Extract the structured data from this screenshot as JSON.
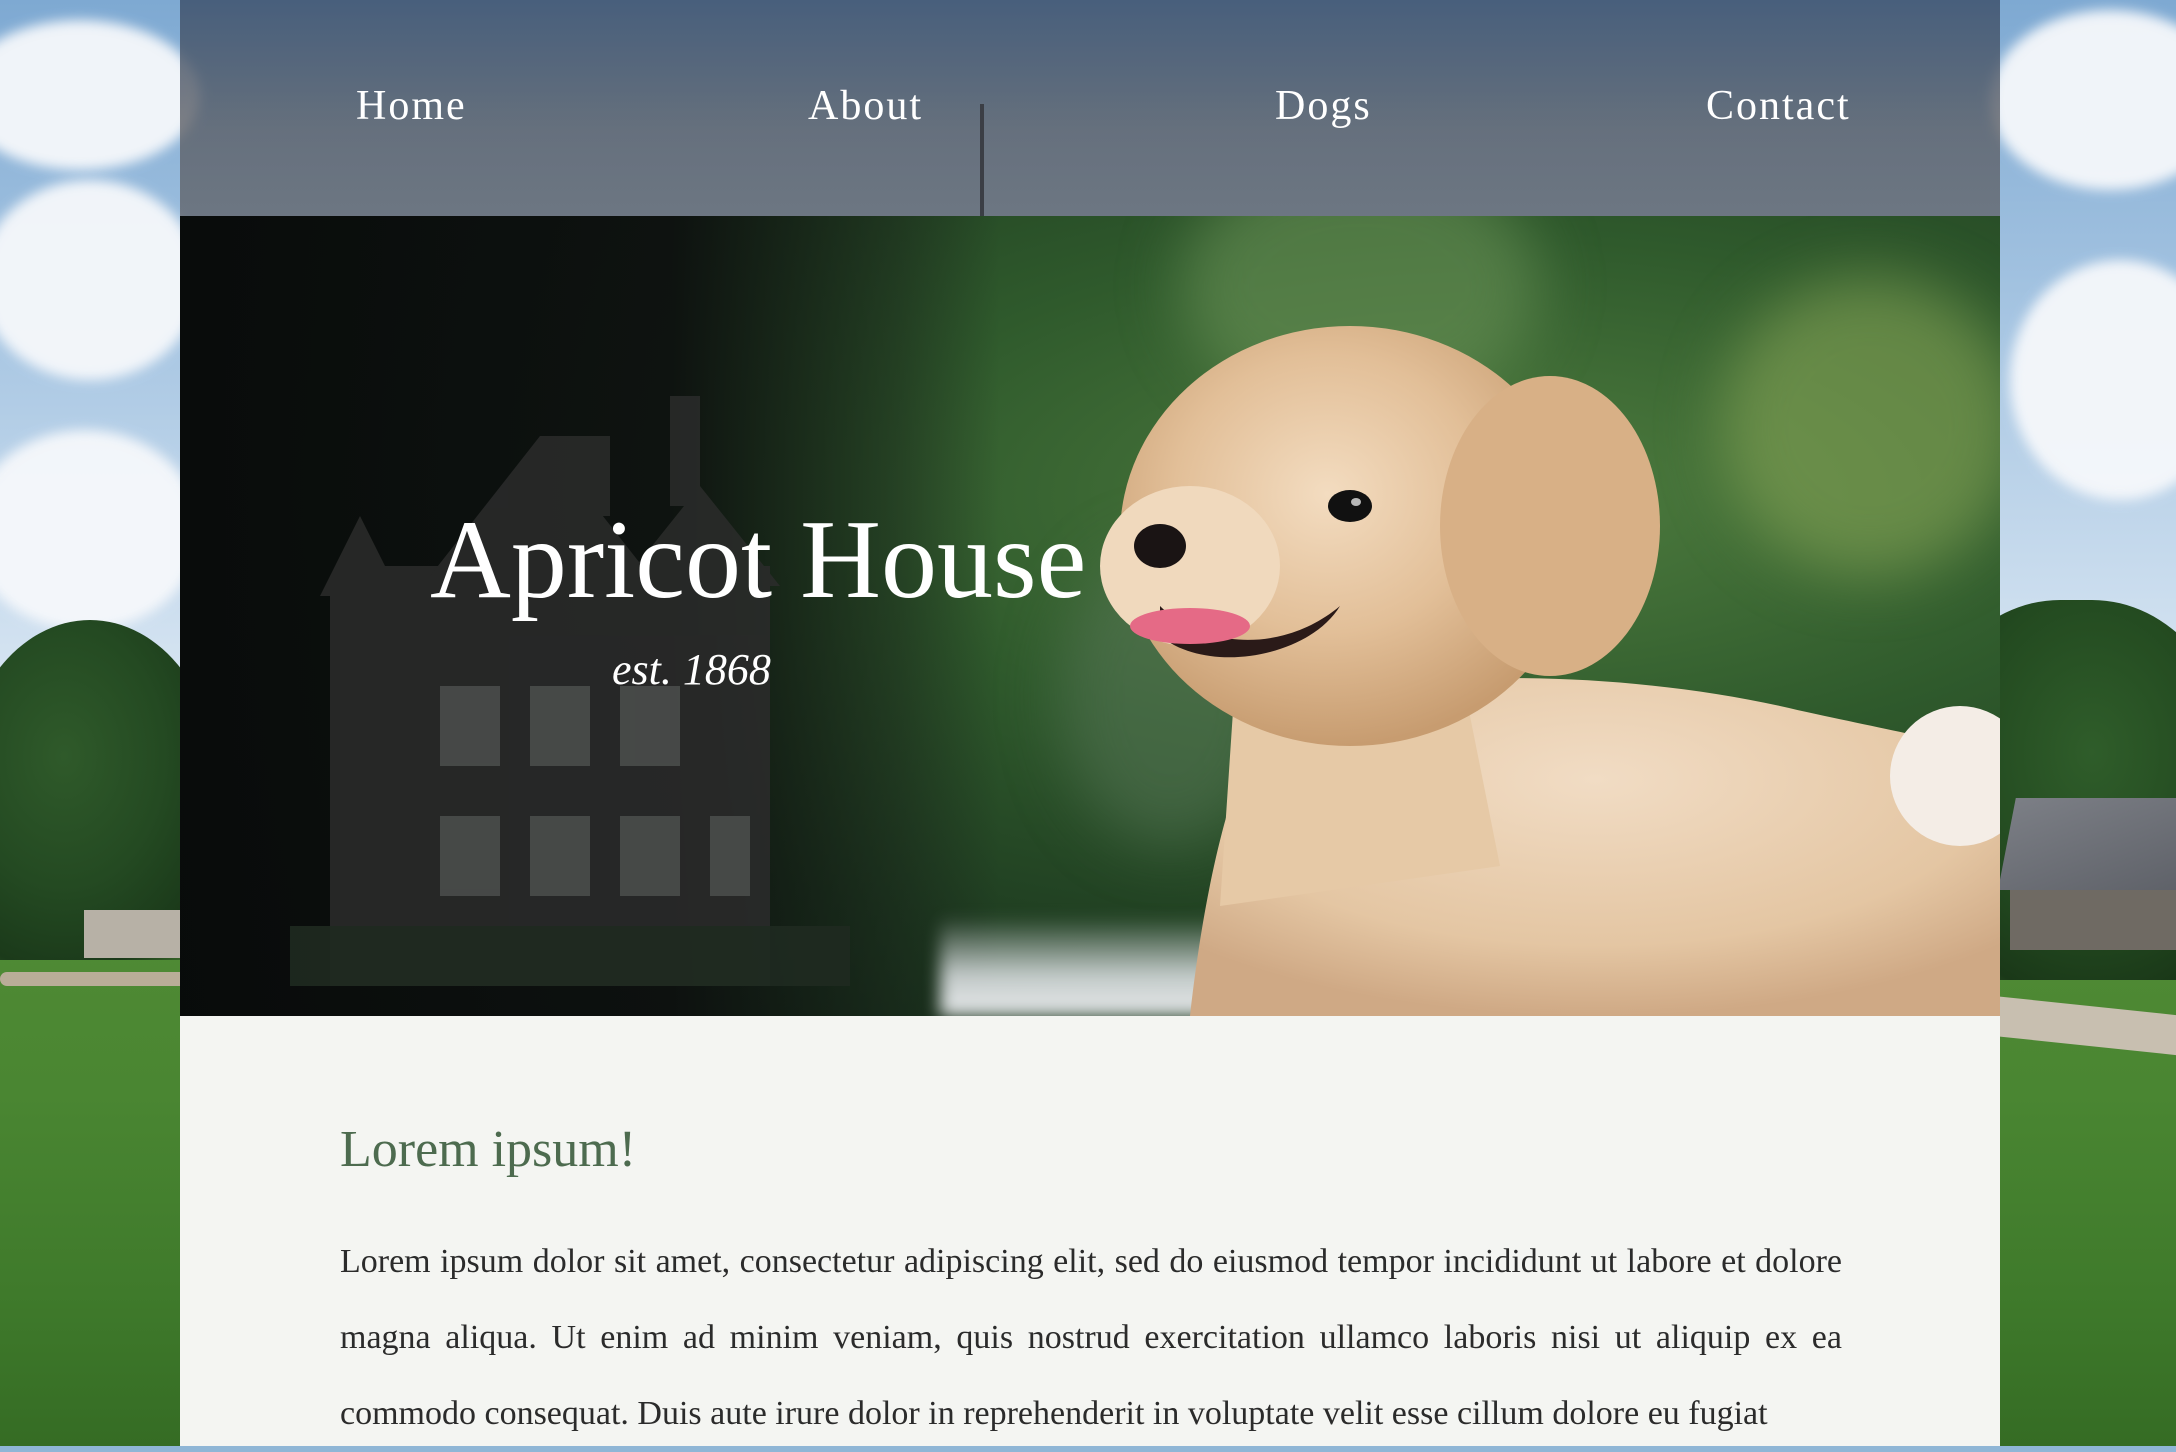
{
  "nav": {
    "items": [
      {
        "label": "Home"
      },
      {
        "label": "About"
      },
      {
        "label": "Dogs"
      },
      {
        "label": "Contact"
      }
    ]
  },
  "hero": {
    "title": "Apricot House",
    "subtitle": "est. 1868"
  },
  "main": {
    "heading": "Lorem ipsum!",
    "paragraph": "Lorem ipsum dolor sit amet, consectetur adipiscing elit, sed do eiusmod tempor incididunt ut labore et dolore magna aliqua. Ut enim ad minim veniam, quis nostrud exercitation ullamco laboris nisi ut aliquip ex ea commodo consequat. Duis aute irure dolor in reprehenderit in voluptate velit esse cillum dolore eu fugiat"
  },
  "colors": {
    "heading_green": "#4d6b4f",
    "nav_overlay": "#5c5c60",
    "content_background": "#f4f5f2",
    "body_text": "#2b2b2b"
  }
}
